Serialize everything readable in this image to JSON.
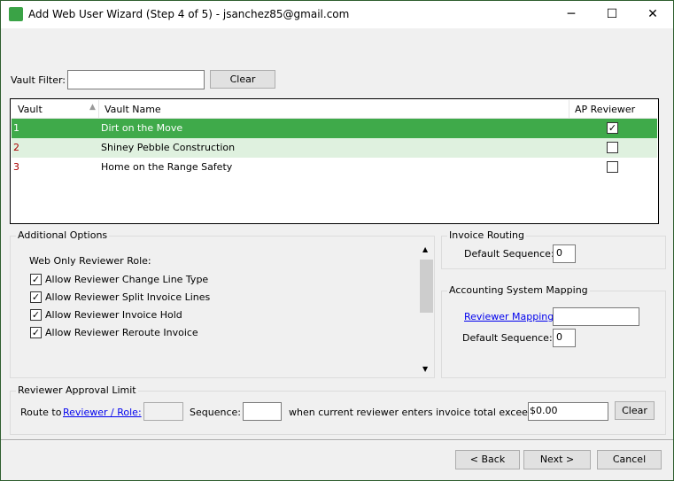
{
  "window": {
    "title": "Add Web User Wizard (Step 4 of 5) - jsanchez85@gmail.com",
    "minimize": "─",
    "maximize": "☐",
    "close": "✕"
  },
  "filter": {
    "label": "Vault Filter:",
    "value": "",
    "clear": "Clear"
  },
  "table": {
    "columns": [
      "Vault",
      "Vault Name",
      "AP Reviewer"
    ],
    "rows": [
      {
        "vault": "1",
        "name": "Dirt on the Move",
        "ap_reviewer": true
      },
      {
        "vault": "2",
        "name": "Shiney Pebble Construction",
        "ap_reviewer": false
      },
      {
        "vault": "3",
        "name": "Home on the Range Safety",
        "ap_reviewer": false
      }
    ],
    "selected_color": "#3faa4a",
    "alt_color": "#dff1df"
  },
  "options": {
    "title": "Additional Options",
    "role_label": "Web Only Reviewer Role:",
    "items": [
      {
        "label": "Allow Reviewer Change Line Type",
        "checked": true
      },
      {
        "label": "Allow Reviewer Split Invoice Lines",
        "checked": true
      },
      {
        "label": "Allow Reviewer Invoice Hold",
        "checked": true
      },
      {
        "label": "Allow Reviewer Reroute Invoice",
        "checked": true
      }
    ]
  },
  "routing": {
    "title": "Invoice Routing",
    "seq_label": "Default Sequence:",
    "seq_value": "0"
  },
  "mapping": {
    "title": "Accounting System Mapping",
    "link": "Reviewer Mapping:",
    "mapping_value": "",
    "seq_label": "Default Sequence:",
    "seq_value": "0"
  },
  "approval": {
    "title": "Reviewer Approval Limit",
    "route_to": "Route to",
    "link": "Reviewer / Role:",
    "role_value": "",
    "seq_label": "Sequence:",
    "seq_value": "",
    "exceed_label": "when current reviewer enters invoice total exceeding:",
    "amount": "$0.00",
    "clear": "Clear"
  },
  "footer": {
    "back": "< Back",
    "next": "Next >",
    "cancel": "Cancel"
  }
}
